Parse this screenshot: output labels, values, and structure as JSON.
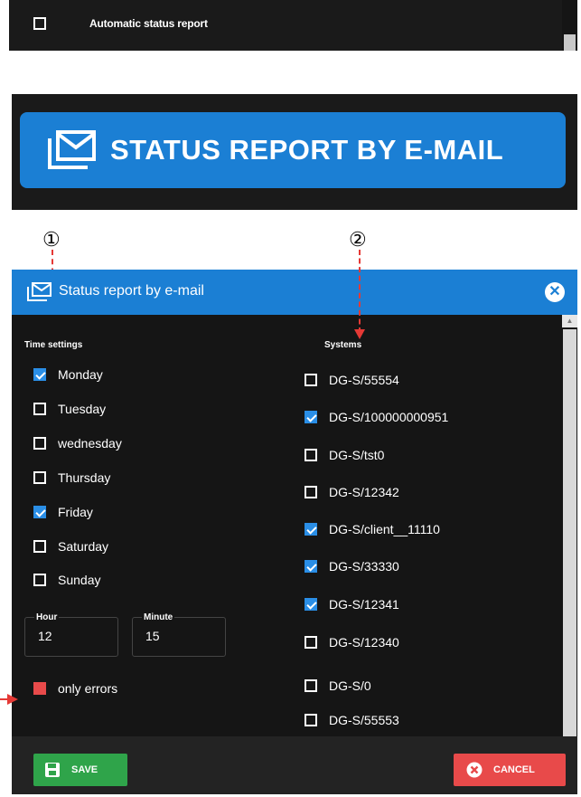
{
  "strip": {
    "label": "Automatic status report",
    "checked": false
  },
  "big_button": {
    "label": "STATUS REPORT BY E-MAIL"
  },
  "markers": {
    "one": "①",
    "two": "②"
  },
  "dialog": {
    "title": "Status report by e-mail",
    "time_section_title": "Time settings",
    "systems_section_title": "Systems",
    "days": [
      {
        "label": "Monday",
        "checked": true
      },
      {
        "label": "Tuesday",
        "checked": false
      },
      {
        "label": "wednesday",
        "checked": false
      },
      {
        "label": "Thursday",
        "checked": false
      },
      {
        "label": "Friday",
        "checked": true
      },
      {
        "label": "Saturday",
        "checked": false
      },
      {
        "label": "Sunday",
        "checked": false
      }
    ],
    "hour": {
      "label": "Hour",
      "value": "12"
    },
    "minute": {
      "label": "Minute",
      "value": "15"
    },
    "only_errors": {
      "label": "only errors",
      "checked": true
    },
    "systems": [
      {
        "label": "DG-S/55554",
        "checked": false
      },
      {
        "label": "DG-S/100000000951",
        "checked": true
      },
      {
        "label": "DG-S/tst0",
        "checked": false
      },
      {
        "label": "DG-S/12342",
        "checked": false
      },
      {
        "label": "DG-S/client__11110",
        "checked": true
      },
      {
        "label": "DG-S/33330",
        "checked": true
      },
      {
        "label": "DG-S/12341",
        "checked": true
      },
      {
        "label": "DG-S/12340",
        "checked": false
      },
      {
        "label": "DG-S/0",
        "checked": false
      },
      {
        "label": "DG-S/55553",
        "checked": false
      }
    ],
    "save_label": "SAVE",
    "cancel_label": "CANCEL"
  },
  "colors": {
    "accent": "#1b7fd4",
    "success": "#2fa44a",
    "danger": "#e84a4a",
    "dark": "#151515",
    "checkbox_blue": "#2a8ee6"
  }
}
